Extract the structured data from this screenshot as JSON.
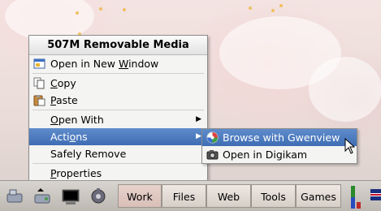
{
  "menu": {
    "title": "507M Removable Media",
    "items": [
      {
        "pre": "Open in New ",
        "u": "W",
        "post": "indow",
        "icon": "new-window-icon"
      },
      {
        "pre": "",
        "u": "C",
        "post": "opy",
        "icon": "copy-icon"
      },
      {
        "pre": "",
        "u": "P",
        "post": "aste",
        "icon": "paste-icon"
      },
      {
        "pre": "",
        "u": "O",
        "post": "pen With",
        "icon": ""
      },
      {
        "pre": "Acti",
        "u": "o",
        "post": "ns",
        "icon": ""
      },
      {
        "pre": "Safely Remove",
        "u": "",
        "post": "",
        "icon": ""
      },
      {
        "pre": "",
        "u": "P",
        "post": "roperties",
        "icon": ""
      }
    ],
    "submenu_arrow": "▶"
  },
  "submenu": {
    "items": [
      {
        "label": "Browse with Gwenview",
        "icon": "gwenview-icon"
      },
      {
        "label": "Open in Digikam",
        "icon": "digikam-icon"
      }
    ]
  },
  "taskbar": {
    "launchers": [
      "system-icon",
      "removable-media-icon",
      "terminal-icon",
      "kcontrol-icon"
    ],
    "desktops": [
      "Work",
      "Files",
      "Web",
      "Tools",
      "Games"
    ],
    "current_desktop": "Work"
  },
  "colors": {
    "highlight": "#4a78bf",
    "menu_bg": "#f4f4f2"
  }
}
